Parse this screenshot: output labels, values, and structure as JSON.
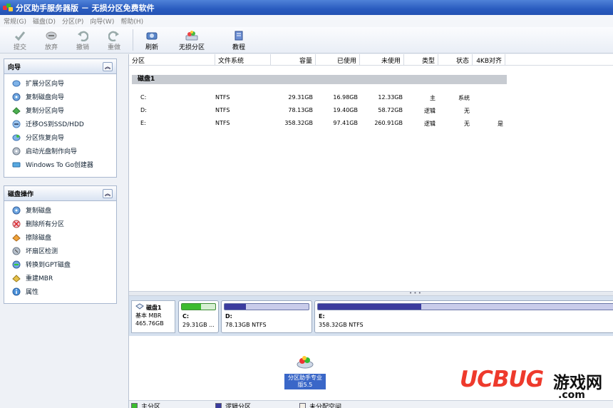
{
  "app": {
    "title": "分区助手服务器版 － 无损分区免费软件"
  },
  "menu": [
    "常规(G)",
    "磁盘(D)",
    "分区(P)",
    "向导(W)",
    "帮助(H)"
  ],
  "toolbar": {
    "commit": "提交",
    "discard": "放弃",
    "undo": "撤销",
    "redo": "重做",
    "refresh": "刷新",
    "lossless": "无损分区",
    "tutorial": "教程"
  },
  "wizard_panel": {
    "title": "向导",
    "items": [
      "扩展分区向导",
      "复制磁盘向导",
      "复制分区向导",
      "迁移OS到SSD/HDD",
      "分区恢复向导",
      "启动光盘制作向导",
      "Windows To Go创建器"
    ]
  },
  "disk_panel": {
    "title": "磁盘操作",
    "items": [
      "复制磁盘",
      "删除所有分区",
      "擦除磁盘",
      "坏扇区检测",
      "转换到GPT磁盘",
      "重建MBR",
      "属性"
    ]
  },
  "table": {
    "columns": [
      "分区",
      "文件系统",
      "容量",
      "已使用",
      "未使用",
      "类型",
      "状态",
      "4KB对齐"
    ],
    "disk_label": "磁盘1",
    "rows": [
      {
        "partition": "C:",
        "fs": "NTFS",
        "capacity": "29.31GB",
        "used": "16.98GB",
        "free": "12.33GB",
        "type": "主",
        "status": "系统",
        "aligned": ""
      },
      {
        "partition": "D:",
        "fs": "NTFS",
        "capacity": "78.13GB",
        "used": "19.40GB",
        "free": "58.72GB",
        "type": "逻辑",
        "status": "无",
        "aligned": ""
      },
      {
        "partition": "E:",
        "fs": "NTFS",
        "capacity": "358.32GB",
        "used": "97.41GB",
        "free": "260.91GB",
        "type": "逻辑",
        "status": "无",
        "aligned": "是"
      }
    ]
  },
  "disk_map": {
    "disk_name": "磁盘1",
    "disk_type": "基本 MBR",
    "disk_size": "465.76GB",
    "partitions": [
      {
        "name": "C:",
        "desc": "29.31GB ...",
        "used_fraction": 0.58,
        "color": "#3dbb2f"
      },
      {
        "name": "D:",
        "desc": "78.13GB NTFS",
        "used_fraction": 0.25,
        "color": "#3b3c9e"
      },
      {
        "name": "E:",
        "desc": "358.32GB NTFS",
        "used_fraction": 0.35,
        "color": "#3b3c9e"
      }
    ]
  },
  "desktop_icon": {
    "line1": "分区助手专业",
    "line2": "版5.5"
  },
  "legend": {
    "primary": "主分区",
    "logical": "逻辑分区",
    "unallocated": "未分配空间",
    "primary_color": "#3dbb2f",
    "logical_color": "#3b3c9e",
    "unallocated_color": "#f3efe6"
  },
  "watermark": {
    "logo": "UCBUG",
    "cn": "游戏网",
    "domain": ".com"
  }
}
